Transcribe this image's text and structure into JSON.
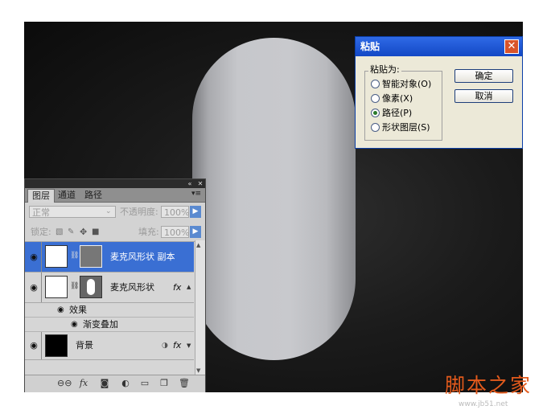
{
  "layers_panel": {
    "tabs": [
      "图层",
      "通道",
      "路径"
    ],
    "blend_mode": "正常",
    "opacity_label": "不透明度:",
    "opacity_value": "100%",
    "lock_label": "锁定:",
    "fill_label": "填充:",
    "fill_value": "100%",
    "layers": [
      {
        "name": "麦克风形状 副本",
        "selected": true
      },
      {
        "name": "麦克风形状",
        "fx": "fx"
      },
      {
        "name": "背景",
        "fx": "fx"
      }
    ],
    "effects_label": "效果",
    "gradient_overlay_label": "渐变叠加",
    "bottom_icons": [
      "link-icon",
      "fx-icon",
      "mask-icon",
      "adjustment-icon",
      "folder-icon",
      "new-layer-icon",
      "trash-icon"
    ]
  },
  "paste_dialog": {
    "title": "粘贴",
    "group_label": "粘贴为:",
    "options": [
      {
        "label": "智能对象(O)",
        "selected": false
      },
      {
        "label": "像素(X)",
        "selected": false
      },
      {
        "label": "路径(P)",
        "selected": true
      },
      {
        "label": "形状图层(S)",
        "selected": false
      }
    ],
    "ok_label": "确定",
    "cancel_label": "取消",
    "close_glyph": "✕"
  },
  "watermark": {
    "logo_text": "脚本之家",
    "url": "www.jb51.net"
  },
  "colors": {
    "selection": "#3a6fd3",
    "dialog_title": "#1f5bd8",
    "watermark": "#e35a1c"
  }
}
